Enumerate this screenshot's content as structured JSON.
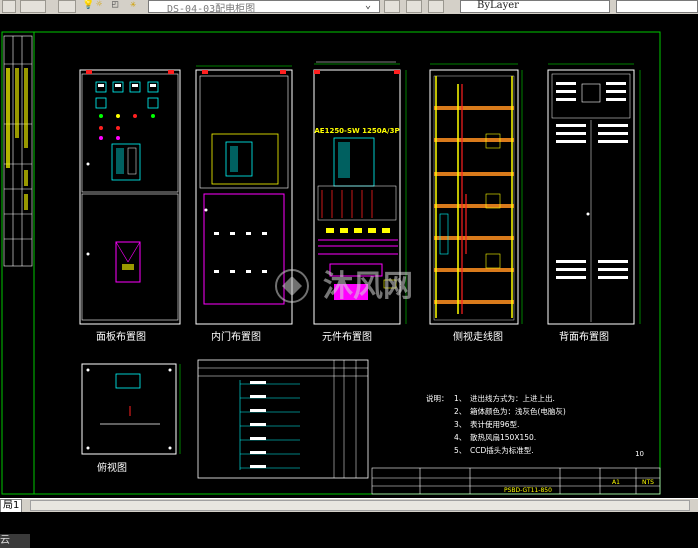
{
  "toolbar": {
    "file_combo_value": "DS-04-03配电柜图",
    "linetype_combo_value": "ByLayer"
  },
  "drawing": {
    "views": [
      {
        "id": "panel",
        "label": "面板布置图"
      },
      {
        "id": "inner-door",
        "label": "内门布置图"
      },
      {
        "id": "component",
        "label": "元件布置图"
      },
      {
        "id": "side-wiring",
        "label": "侧视走线图"
      },
      {
        "id": "rear-panel",
        "label": "背面布置图"
      },
      {
        "id": "top-view",
        "label": "俯视图"
      }
    ],
    "component_header": "AE1250-SW 1250A/3P",
    "watermark": "沐风网",
    "notes": {
      "title": "说明：",
      "items": [
        {
          "num": "1、",
          "text": "进出线方式为：上进上出."
        },
        {
          "num": "2、",
          "text": "箱体颜色为：浅灰色(电脑灰)"
        },
        {
          "num": "3、",
          "text": "表计使用96型."
        },
        {
          "num": "4、",
          "text": "散热风扇150X150."
        },
        {
          "num": "5、",
          "text": "CCD插头为标准型."
        }
      ]
    },
    "sheet_number": "10",
    "title_block": {
      "code": "PSBD-GT11-850",
      "scale": "A1",
      "nts": "NTS"
    }
  },
  "tabs": [
    {
      "label": "局1"
    }
  ],
  "command_line": {
    "prompt": "云"
  },
  "colors": {
    "background": "#000000",
    "frame": "#00c800",
    "cabinet": "#ffffff",
    "accent_cyan": "#00ffff",
    "accent_magenta": "#ff00ff",
    "accent_yellow": "#ffff00",
    "accent_orange": "#ff9020",
    "accent_red": "#ff2020"
  }
}
